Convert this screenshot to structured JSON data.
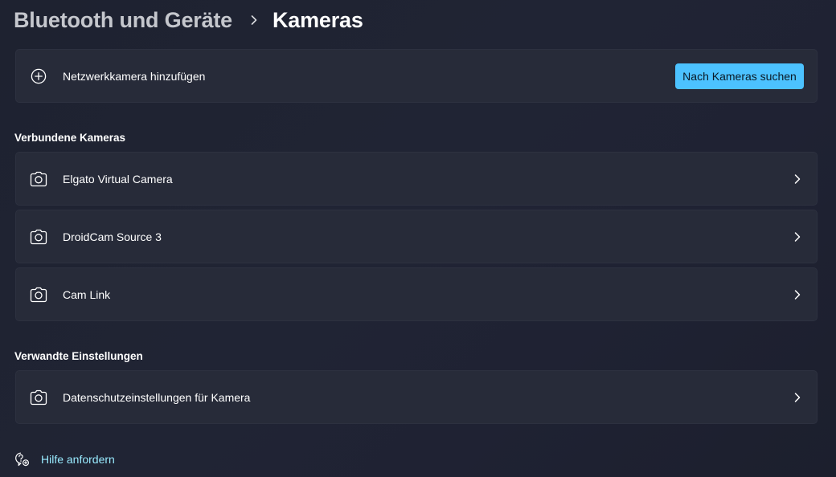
{
  "breadcrumb": {
    "parent": "Bluetooth und Geräte",
    "current": "Kameras"
  },
  "add_camera": {
    "label": "Netzwerkkamera hinzufügen",
    "icon": "add-circle-icon",
    "button_label": "Nach Kameras suchen"
  },
  "connected": {
    "header": "Verbundene Kameras",
    "items": [
      {
        "label": "Elgato Virtual Camera",
        "icon": "camera-icon"
      },
      {
        "label": "DroidCam Source 3",
        "icon": "camera-icon"
      },
      {
        "label": "Cam Link",
        "icon": "camera-icon"
      }
    ]
  },
  "related": {
    "header": "Verwandte Einstellungen",
    "items": [
      {
        "label": "Datenschutzeinstellungen für Kamera",
        "icon": "camera-icon"
      }
    ]
  },
  "help": {
    "label": "Hilfe anfordern",
    "icon": "help-chat-icon"
  },
  "colors": {
    "accent": "#4cc2ff",
    "link": "#99ebff",
    "card": "#272b39",
    "background": "#1f2332"
  }
}
